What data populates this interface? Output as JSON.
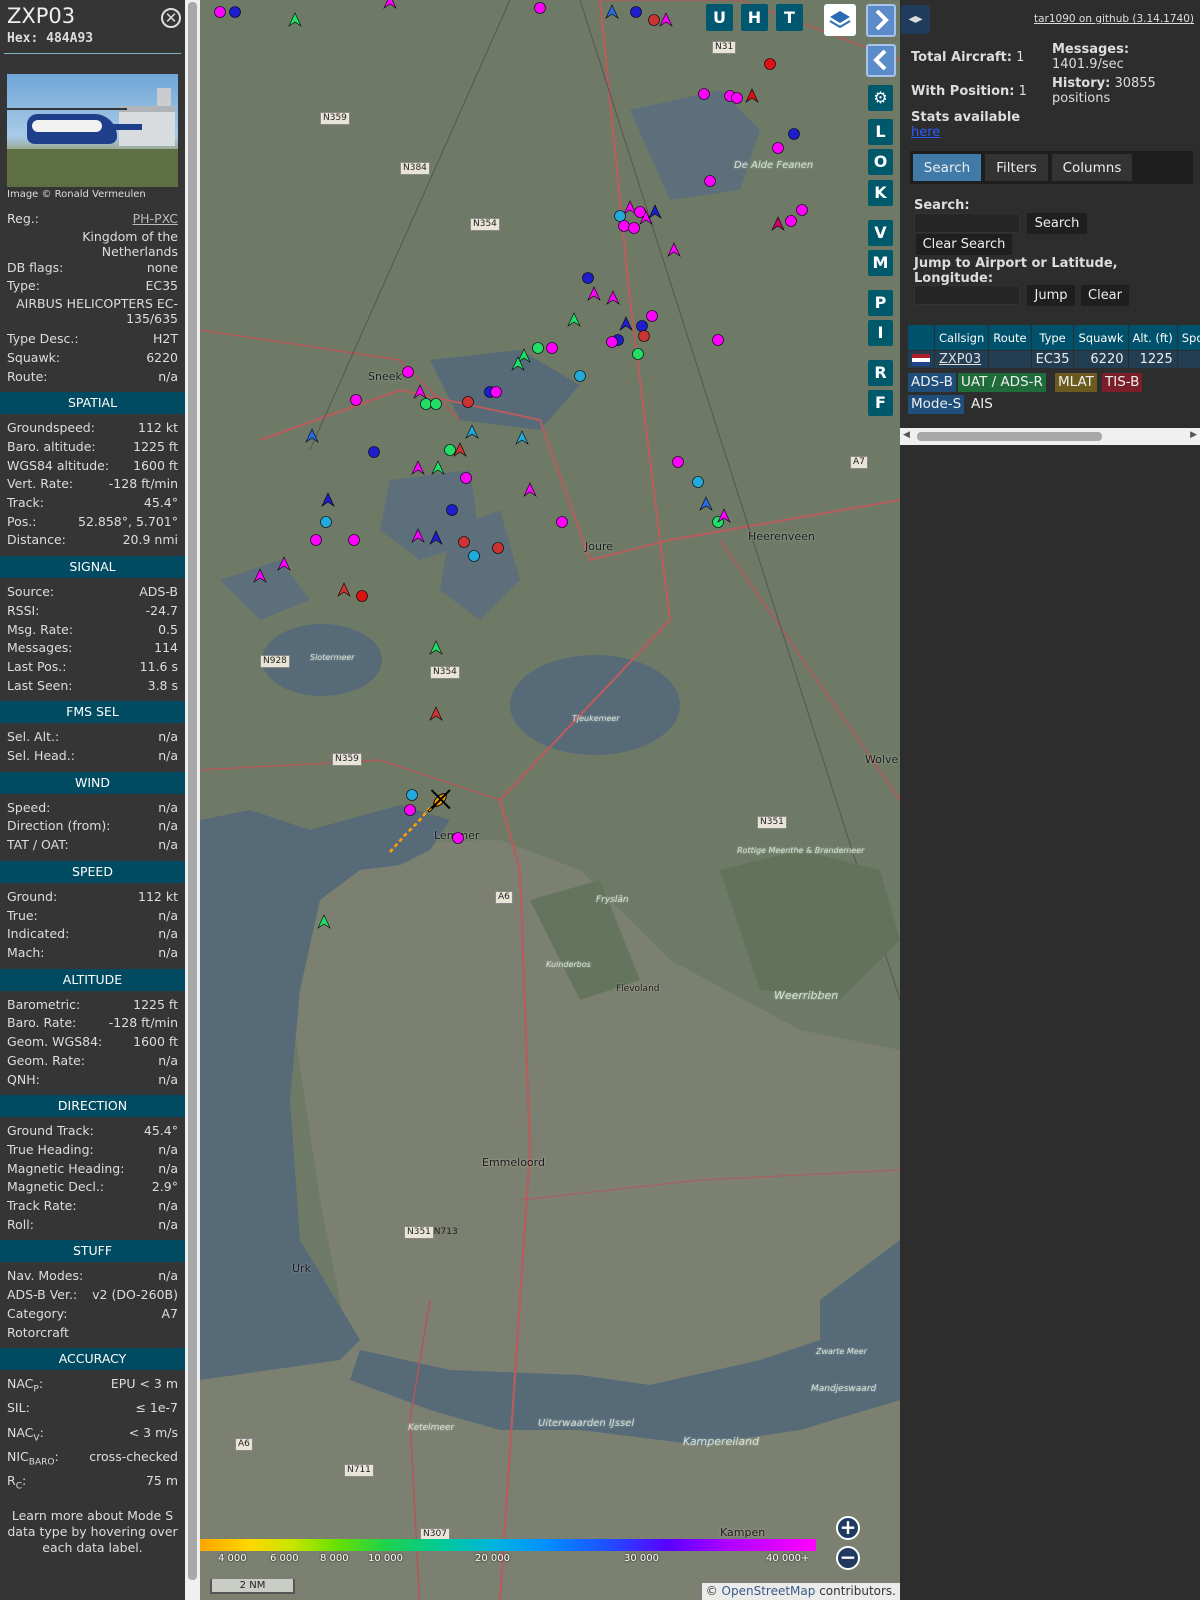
{
  "info": {
    "callsign": "ZXP03",
    "hex_label": "Hex: 484A93",
    "close_icon": "close-icon",
    "photo_credit": "Image © Ronald Vermeulen",
    "reg_label": "Reg.:",
    "reg_value": "PH-PXC",
    "country": "Kingdom of the Netherlands",
    "db_flags_label": "DB flags:",
    "db_flags_value": "none",
    "type_label": "Type:",
    "type_value": "EC35",
    "type_full": "AIRBUS HELICOPTERS EC-135/635",
    "type_desc_label": "Type Desc.:",
    "type_desc_value": "H2T",
    "squawk_label": "Squawk:",
    "squawk_value": "6220",
    "route_label": "Route:",
    "route_value": "n/a",
    "sections": {
      "spatial": "SPATIAL",
      "signal": "SIGNAL",
      "fms": "FMS SEL",
      "wind": "WIND",
      "speed": "SPEED",
      "altitude": "ALTITUDE",
      "direction": "DIRECTION",
      "stuff": "STUFF",
      "accuracy": "ACCURACY"
    },
    "spatial": [
      {
        "k": "Groundspeed:",
        "v": "112 kt"
      },
      {
        "k": "Baro. altitude:",
        "v": "1225 ft"
      },
      {
        "k": "WGS84 altitude:",
        "v": "1600 ft"
      },
      {
        "k": "Vert. Rate:",
        "v": "-128 ft/min"
      },
      {
        "k": "Track:",
        "v": "45.4°"
      },
      {
        "k": "Pos.:",
        "v": "52.858°, 5.701°"
      },
      {
        "k": "Distance:",
        "v": "20.9 nmi"
      }
    ],
    "signal": [
      {
        "k": "Source:",
        "v": "ADS-B"
      },
      {
        "k": "RSSI:",
        "v": "-24.7"
      },
      {
        "k": "Msg. Rate:",
        "v": "0.5"
      },
      {
        "k": "Messages:",
        "v": "114"
      },
      {
        "k": "Last Pos.:",
        "v": "11.6 s"
      },
      {
        "k": "Last Seen:",
        "v": "3.8 s"
      }
    ],
    "fms": [
      {
        "k": "Sel. Alt.:",
        "v": "n/a"
      },
      {
        "k": "Sel. Head.:",
        "v": "n/a"
      }
    ],
    "wind": [
      {
        "k": "Speed:",
        "v": "n/a"
      },
      {
        "k": "Direction (from):",
        "v": "n/a"
      },
      {
        "k": "TAT / OAT:",
        "v": "n/a"
      }
    ],
    "speed": [
      {
        "k": "Ground:",
        "v": "112 kt"
      },
      {
        "k": "True:",
        "v": "n/a"
      },
      {
        "k": "Indicated:",
        "v": "n/a"
      },
      {
        "k": "Mach:",
        "v": "n/a"
      }
    ],
    "altitude": [
      {
        "k": "Barometric:",
        "v": "1225 ft"
      },
      {
        "k": "Baro. Rate:",
        "v": "-128 ft/min"
      },
      {
        "k": "Geom. WGS84:",
        "v": "1600 ft"
      },
      {
        "k": "Geom. Rate:",
        "v": "n/a"
      },
      {
        "k": "QNH:",
        "v": "n/a"
      }
    ],
    "direction": [
      {
        "k": "Ground Track:",
        "v": "45.4°"
      },
      {
        "k": "True Heading:",
        "v": "n/a"
      },
      {
        "k": "Magnetic Heading:",
        "v": "n/a"
      },
      {
        "k": "Magnetic Decl.:",
        "v": "2.9°"
      },
      {
        "k": "Track Rate:",
        "v": "n/a"
      },
      {
        "k": "Roll:",
        "v": "n/a"
      }
    ],
    "stuff": [
      {
        "k": "Nav. Modes:",
        "v": "n/a"
      },
      {
        "k": "ADS-B Ver.:",
        "v": "v2 (DO-260B)"
      },
      {
        "k": "Category:",
        "v": "A7"
      },
      {
        "k": "Rotorcraft",
        "v": ""
      }
    ],
    "accuracy": [
      {
        "k": "NAC",
        "sub": "P",
        "v": "EPU < 3 m"
      },
      {
        "k": "SIL:",
        "sub": "",
        "v": "≤ 1e-7"
      },
      {
        "k": "NAC",
        "sub": "V",
        "v": "< 3 m/s"
      },
      {
        "k": "NIC",
        "sub": "BARO",
        "v": "cross-checked"
      },
      {
        "k": "R",
        "sub": "C",
        "v": "75 m"
      }
    ],
    "learn_more": "Learn more about Mode S data type by hovering over each data label."
  },
  "map": {
    "top_buttons": [
      "U",
      "H",
      "T"
    ],
    "side_buttons": [
      "L",
      "O",
      "K",
      "V",
      "M",
      "P",
      "I",
      "R",
      "F"
    ],
    "icons": {
      "layers": "layers-icon",
      "expand": "chevron-right-icon",
      "collapse": "chevron-left-icon",
      "settings": "gear-icon",
      "zoom_in": "plus-icon",
      "zoom_out": "minus-icon"
    },
    "place_labels": [
      {
        "name": "Sneek"
      },
      {
        "name": "Joure"
      },
      {
        "name": "Heerenveen"
      },
      {
        "name": "Lemmer"
      },
      {
        "name": "Emmeloord"
      },
      {
        "name": "Urk"
      },
      {
        "name": "Kampen"
      },
      {
        "name": "Kampereiland"
      },
      {
        "name": "Weerribben"
      },
      {
        "name": "De Alde Feanen"
      },
      {
        "name": "Wolve"
      },
      {
        "name": "Mandjeswaard"
      },
      {
        "name": "Uiterwaarden IJssel"
      },
      {
        "name": "Ketelmeer"
      },
      {
        "name": "Slotermeer"
      },
      {
        "name": "Tjeukemeer"
      },
      {
        "name": "Kuinderbos"
      },
      {
        "name": "Flevoland"
      },
      {
        "name": "Zwarte Meer"
      },
      {
        "name": "Rottige Meenthe & Brandemeer"
      },
      {
        "name": "Fryslân"
      }
    ],
    "road_labels": [
      "N31",
      "N359",
      "N384",
      "N354",
      "N928",
      "N354",
      "N359",
      "A6",
      "N351",
      "N351 N713",
      "A7",
      "N711",
      "A6",
      "N307"
    ],
    "altitude_scale": [
      "4 000",
      "6 000",
      "8 000",
      "10 000",
      "20 000",
      "30 000",
      "40 000+"
    ],
    "scale_bar": "2 NM",
    "attribution_prefix": "© ",
    "attribution_link": "OpenStreetMap",
    "attribution_suffix": " contributors."
  },
  "sidebar": {
    "toggle_icon": "left-right-arrows-icon",
    "github": "tar1090 on github (3.14.1740)",
    "total_aircraft_label": "Total Aircraft:",
    "total_aircraft": "1",
    "with_position_label": "With Position:",
    "with_position": "1",
    "messages_label": "Messages:",
    "messages": "1401.9/sec",
    "history_label": "History:",
    "history": "30855 positions",
    "stats_label": "Stats available",
    "stats_link": "here",
    "tabs": [
      "Search",
      "Filters",
      "Columns"
    ],
    "search_label": "Search:",
    "search_placeholder": "",
    "search_button": "Search",
    "clear_search_button": "Clear Search",
    "jump_label": "Jump to Airport or Latitude, Longitude:",
    "jump_placeholder": "",
    "jump_button": "Jump",
    "clear_button": "Clear",
    "table_headers": [
      "Callsign",
      "Route",
      "Type",
      "Squawk",
      "Alt. (ft)",
      "Spd."
    ],
    "rows": [
      {
        "flag": "netherlands-flag-icon",
        "callsign": "ZXP03",
        "route": "",
        "type": "EC35",
        "squawk": "6220",
        "alt": "1225",
        "spd": ""
      }
    ],
    "sources": [
      "ADS-B",
      "UAT / ADS-R",
      "MLAT",
      "TIS-B",
      "Mode-S",
      "AIS"
    ],
    "source_colors": [
      "#1f4e7a",
      "#1f6b3a",
      "#6b5a1f",
      "#7a1f2a",
      "#1f4e7a",
      "#2d2d2d"
    ]
  }
}
